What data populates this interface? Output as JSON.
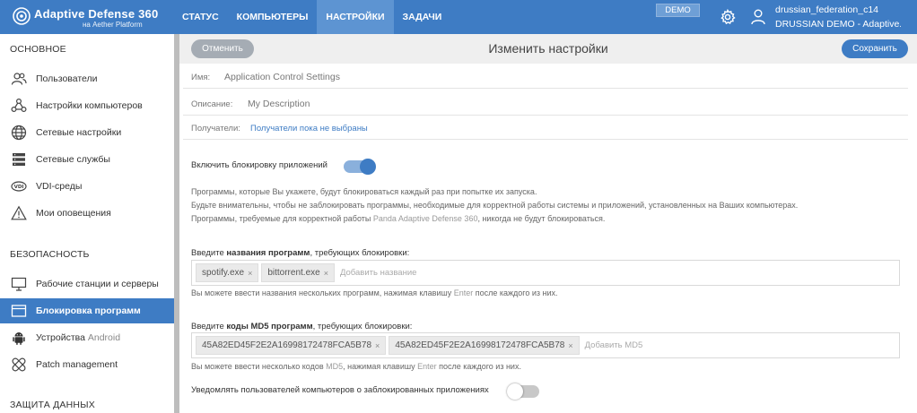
{
  "app": {
    "title": "Adaptive Defense 360",
    "subtitle": "на Aether Platform"
  },
  "nav": {
    "items": [
      {
        "label": "СТАТУС",
        "active": false
      },
      {
        "label": "КОМПЬЮТЕРЫ",
        "active": false
      },
      {
        "label": "НАСТРОЙКИ",
        "active": true
      },
      {
        "label": "ЗАДАЧИ",
        "active": false
      }
    ]
  },
  "header": {
    "demo_badge": "DEMO",
    "user_name": "drussian_federation_c14",
    "user_company": "DRUSSIAN DEMO - Adaptive..."
  },
  "sidebar": {
    "sections": [
      "ОСНОВНОЕ",
      "БЕЗОПАСНОСТЬ",
      "ЗАЩИТА ДАННЫХ"
    ],
    "items": [
      {
        "label": "Пользователи",
        "icon": "users-icon",
        "active": false
      },
      {
        "label": "Настройки компьютеров",
        "icon": "nodes-icon",
        "active": false
      },
      {
        "label": "Сетевые настройки",
        "icon": "globe-icon",
        "active": false
      },
      {
        "label": "Сетевые службы",
        "icon": "server-icon",
        "active": false
      },
      {
        "label": "VDI-среды",
        "icon": "vdi-icon",
        "active": false
      },
      {
        "label": "Мои оповещения",
        "icon": "warning-icon",
        "active": false
      },
      {
        "label": "Рабочие станции и серверы",
        "icon": "monitor-icon",
        "active": false
      },
      {
        "label": "Блокировка программ",
        "icon": "window-icon",
        "active": true
      },
      {
        "label_prefix": "Устройства",
        "label_suffix": "Android",
        "icon": "android-icon",
        "active": false
      },
      {
        "label": "Patch management",
        "icon": "patch-icon",
        "active": false
      }
    ]
  },
  "toolbar": {
    "cancel_label": "Отменить",
    "page_title": "Изменить настройки",
    "save_label": "Сохранить"
  },
  "form": {
    "name_label": "Имя:",
    "name_value": "Application Control Settings",
    "description_label": "Описание:",
    "description_value": "My Description",
    "recipients_label": "Получатели:",
    "recipients_link": "Получатели пока не выбраны",
    "block_toggle_label": "Включить блокировку приложений",
    "block_toggle_on": true,
    "info_line1": "Программы, которые Вы укажете, будут блокироваться каждый раз при попытке их запуска.",
    "info_line2": "Будьте внимательны, чтобы не заблокировать программы, необходимые для корректной работы системы и приложений, установленных на Ваших компьютерах.",
    "info_line3_prefix": "Программы, требуемые для корректной работы",
    "info_line3_product": "Panda Adaptive Defense 360",
    "info_line3_suffix": ", никогда не будут блокироваться.",
    "names_title_prefix": "Введите",
    "names_title_bold": "названия программ",
    "names_title_suffix": ", требующих блокировки:",
    "names_tags": [
      "spotify.exe",
      "bittorrent.exe"
    ],
    "names_placeholder": "Добавить название",
    "names_hint_prefix": "Вы можете ввести названия нескольких программ, нажимая клавишу",
    "names_hint_key": "Enter",
    "names_hint_suffix": "после каждого из них.",
    "md5_title_prefix": "Введите",
    "md5_title_bold": "коды MD5 программ",
    "md5_title_suffix": ", требующих блокировки:",
    "md5_tags": [
      "45A82ED45F2E2A16998172478FCA5B78",
      "45A82ED45F2E2A16998172478FCA5B78"
    ],
    "md5_placeholder_prefix": "Добавить",
    "md5_placeholder_key": "MD5",
    "md5_hint_prefix": "Вы можете ввести несколько кодов",
    "md5_hint_key1": "MD5",
    "md5_hint_mid": ", нажимая клавишу",
    "md5_hint_key2": "Enter",
    "md5_hint_suffix": "после каждого из них.",
    "notify_toggle_label": "Уведомлять пользователей компьютеров о заблокированных приложениях",
    "notify_toggle_on": false
  },
  "colors": {
    "brand": "#3e7cc4",
    "nav_active": "#5d94d2",
    "cancel": "#a5acb4",
    "header_bg": "#efefef"
  }
}
